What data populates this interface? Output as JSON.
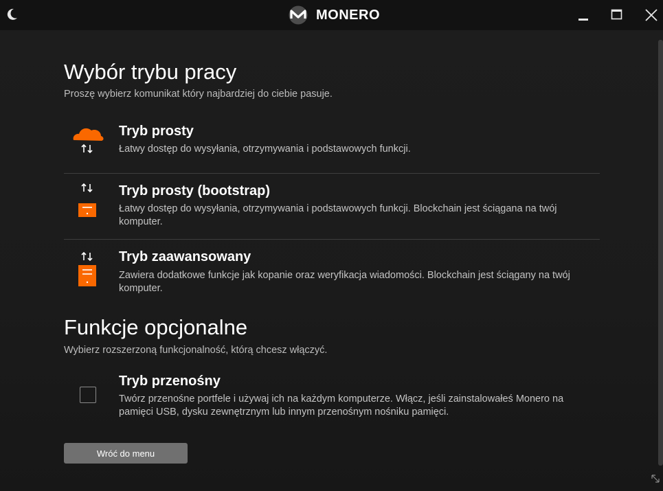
{
  "titlebar": {
    "app_name": "MONERO",
    "theme_icon": "moon-icon",
    "logo_icon": "monero-logo-icon",
    "minimize_icon": "minimize-icon",
    "maximize_icon": "maximize-icon",
    "close_icon": "close-icon"
  },
  "mode_section": {
    "heading": "Wybór trybu pracy",
    "subtitle": "Proszę wybierz komunikat który najbardziej do ciebie pasuje.",
    "options": [
      {
        "title": "Tryb prosty",
        "description": "Łatwy dostęp do wysyłania, otrzymywania i podstawowych funkcji.",
        "icon": "cloud-icon"
      },
      {
        "title": "Tryb prosty (bootstrap)",
        "description": "Łatwy dostęp do wysyłania, otrzymywania i podstawowych funkcji. Blockchain jest ściągana na twój komputer.",
        "icon": "server-small-icon"
      },
      {
        "title": "Tryb zaawansowany",
        "description": "Zawiera dodatkowe funkcje jak kopanie oraz weryfikacja wiadomości. Blockchain jest ściągany na twój komputer.",
        "icon": "server-large-icon"
      }
    ]
  },
  "optional_section": {
    "heading": "Funkcje opcjonalne",
    "subtitle": "Wybierz rozszerzoną funkcjonalność, którą chcesz włączyć.",
    "portable": {
      "title": "Tryb przenośny",
      "description": "Twórz przenośne portfele i używaj ich na każdym komputerze. Włącz, jeśli zainstalowałeś Monero na pamięci USB, dysku zewnętrznym lub innym przenośnym nośniku pamięci.",
      "checked": false
    }
  },
  "back_button": {
    "label": "Wróć do menu"
  },
  "colors": {
    "accent": "#fa6800",
    "background": "#1a1a1a",
    "button": "#707070"
  }
}
